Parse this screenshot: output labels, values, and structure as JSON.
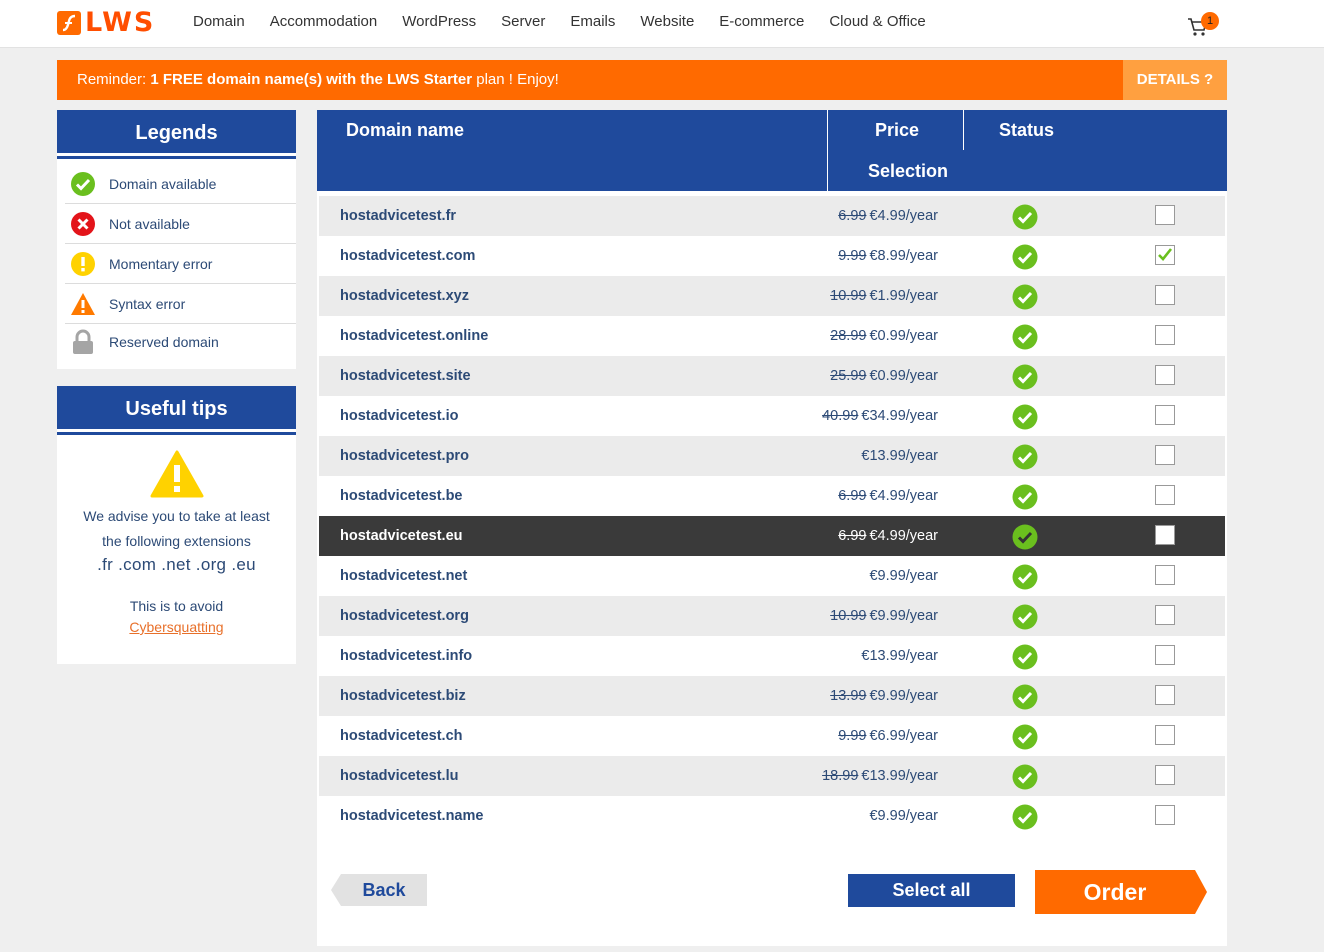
{
  "header": {
    "logo_text": "LWS",
    "nav": [
      "Domain",
      "Accommodation",
      "WordPress",
      "Server",
      "Emails",
      "Website",
      "E-commerce",
      "Cloud & Office"
    ],
    "cart_count": "1"
  },
  "reminder": {
    "prefix": "Reminder: ",
    "highlight": "1 FREE domain name(s) with the LWS Starter",
    "suffix": " plan ! Enjoy!",
    "details_label": "DETAILS ?"
  },
  "legends": {
    "title": "Legends",
    "items": [
      {
        "icon": "check-circle-icon",
        "label": "Domain available"
      },
      {
        "icon": "x-circle-icon",
        "label": "Not available"
      },
      {
        "icon": "exclamation-circle-icon",
        "label": "Momentary error"
      },
      {
        "icon": "warning-triangle-icon",
        "label": "Syntax error"
      },
      {
        "icon": "lock-icon",
        "label": "Reserved domain"
      }
    ]
  },
  "tips": {
    "title": "Useful tips",
    "line1": "We advise you to take at least",
    "line2": "the following extensions",
    "extensions": ".fr .com .net .org .eu",
    "avoid": "This is to avoid",
    "link": "Cybersquatting"
  },
  "table": {
    "headers": {
      "domain": "Domain name",
      "price": "Price",
      "status": "Status",
      "selection": "Selection"
    },
    "rows": [
      {
        "domain": "hostadvicetest.fr",
        "old_price": "6.99",
        "price": "€4.99/year",
        "checked": false
      },
      {
        "domain": "hostadvicetest.com",
        "old_price": "9.99",
        "price": "€8.99/year",
        "checked": true
      },
      {
        "domain": "hostadvicetest.xyz",
        "old_price": "10.99",
        "price": "€1.99/year",
        "checked": false
      },
      {
        "domain": "hostadvicetest.online",
        "old_price": "28.99",
        "price": "€0.99/year",
        "checked": false
      },
      {
        "domain": "hostadvicetest.site",
        "old_price": "25.99",
        "price": "€0.99/year",
        "checked": false
      },
      {
        "domain": "hostadvicetest.io",
        "old_price": "40.99",
        "price": "€34.99/year",
        "checked": false
      },
      {
        "domain": "hostadvicetest.pro",
        "old_price": "",
        "price": "€13.99/year",
        "checked": false
      },
      {
        "domain": "hostadvicetest.be",
        "old_price": "6.99",
        "price": "€4.99/year",
        "checked": false
      },
      {
        "domain": "hostadvicetest.eu",
        "old_price": "6.99",
        "price": "€4.99/year",
        "checked": false,
        "highlight": true
      },
      {
        "domain": "hostadvicetest.net",
        "old_price": "",
        "price": "€9.99/year",
        "checked": false
      },
      {
        "domain": "hostadvicetest.org",
        "old_price": "10.99",
        "price": "€9.99/year",
        "checked": false
      },
      {
        "domain": "hostadvicetest.info",
        "old_price": "",
        "price": "€13.99/year",
        "checked": false
      },
      {
        "domain": "hostadvicetest.biz",
        "old_price": "13.99",
        "price": "€9.99/year",
        "checked": false
      },
      {
        "domain": "hostadvicetest.ch",
        "old_price": "9.99",
        "price": "€6.99/year",
        "checked": false
      },
      {
        "domain": "hostadvicetest.lu",
        "old_price": "18.99",
        "price": "€13.99/year",
        "checked": false
      },
      {
        "domain": "hostadvicetest.name",
        "old_price": "",
        "price": "€9.99/year",
        "checked": false
      }
    ]
  },
  "actions": {
    "back": "Back",
    "select_all": "Select all",
    "order": "Order"
  },
  "colors": {
    "brand_orange": "#ff6a00",
    "brand_blue": "#1f4a9c",
    "available_green": "#6abf1e"
  }
}
